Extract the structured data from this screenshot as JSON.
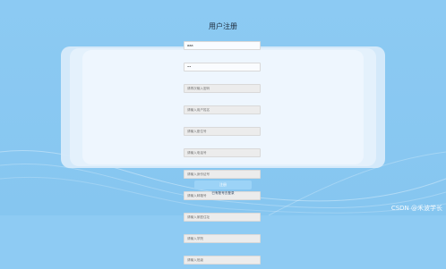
{
  "page_title": "用户注册",
  "form": {
    "username_value": "aaa",
    "password_value": "••",
    "fields": [
      {
        "placeholder": "请再次输入密码"
      },
      {
        "placeholder": "请输入用户姓名"
      },
      {
        "placeholder": "请输入座位号"
      },
      {
        "placeholder": "请输入电话号"
      },
      {
        "placeholder": "请输入身份证号"
      },
      {
        "placeholder": "请输入邮箱号"
      },
      {
        "placeholder": "请输入家庭住址"
      },
      {
        "placeholder": "请输入学院"
      },
      {
        "placeholder": "请输入班级"
      }
    ]
  },
  "submit_label": "注册",
  "login_link_label": "已有账号去登录",
  "watermark": "CSDN @禾波学长"
}
